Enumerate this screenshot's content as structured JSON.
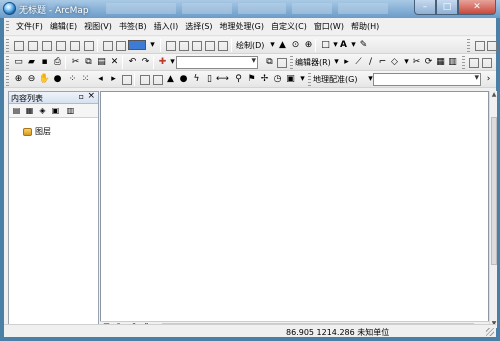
{
  "window": {
    "title": "无标题 - ArcMap",
    "minimize_glyph": "–",
    "maximize_glyph": "□",
    "close_glyph": "✕"
  },
  "menu": [
    "文件(F)",
    "编辑(E)",
    "视图(V)",
    "书签(B)",
    "插入(I)",
    "选择(S)",
    "地理处理(G)",
    "自定义(C)",
    "窗口(W)",
    "帮助(H)"
  ],
  "toolbars": {
    "draw_label": "绘制(D)",
    "editor_label": "编辑器(R)",
    "georef_label": "地理配准(G)",
    "font_glyph": "A",
    "fill_color": "#3d7bd6"
  },
  "toc": {
    "title": "内容列表",
    "pin_glyph": "▫",
    "close_glyph": "×",
    "layer_label": "图层"
  },
  "status": {
    "coords": "86.905  1214.286 未知单位"
  }
}
